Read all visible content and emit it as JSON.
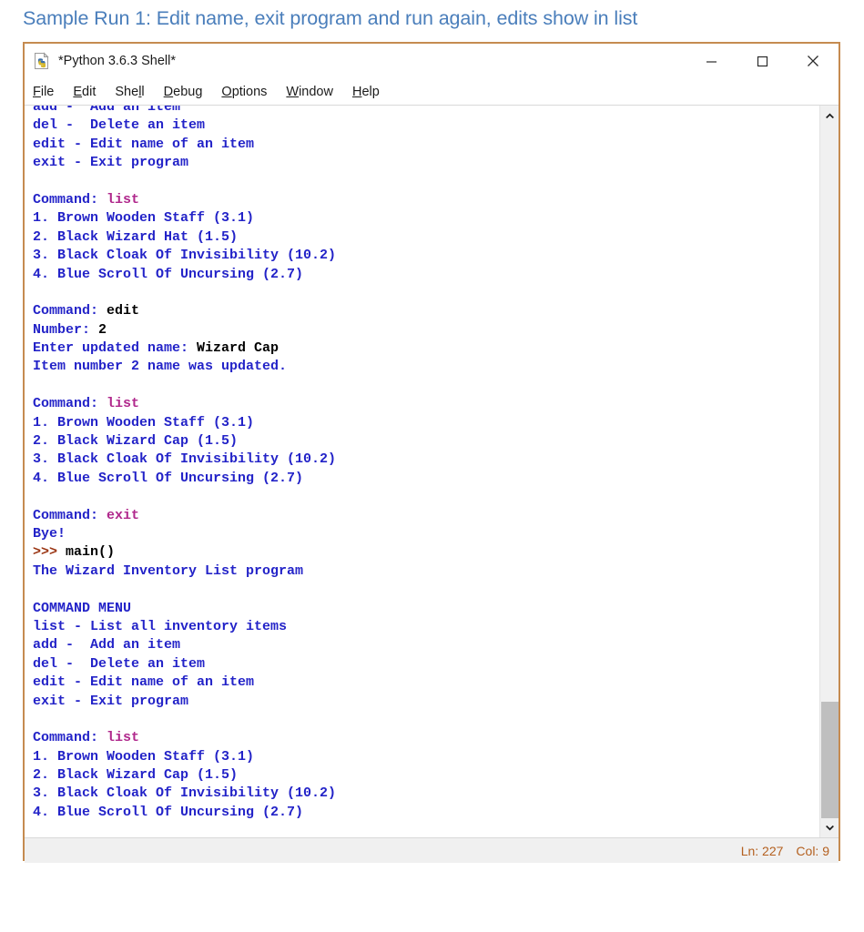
{
  "caption": "Sample Run 1: Edit name, exit program and run again, edits show in list",
  "window": {
    "title": "*Python 3.6.3 Shell*",
    "icon": "python-file-icon",
    "controls": {
      "minimize": "minimize-icon",
      "maximize": "maximize-icon",
      "close": "close-icon"
    }
  },
  "menubar": {
    "items": [
      {
        "label": "File",
        "accel_index": 0
      },
      {
        "label": "Edit",
        "accel_index": 0
      },
      {
        "label": "Shell",
        "accel_index": 3
      },
      {
        "label": "Debug",
        "accel_index": 0
      },
      {
        "label": "Options",
        "accel_index": 0
      },
      {
        "label": "Window",
        "accel_index": 0
      },
      {
        "label": "Help",
        "accel_index": 0
      }
    ]
  },
  "shell": {
    "scrollbar": {
      "up_arrow": "chevron-up-icon",
      "down_arrow": "chevron-down-icon",
      "thumb": "scrollbar-thumb"
    },
    "lines": [
      [
        {
          "t": "add -  Add an item",
          "c": "out"
        }
      ],
      [
        {
          "t": "del -  Delete an item",
          "c": "out"
        }
      ],
      [
        {
          "t": "edit - Edit name of an item",
          "c": "out"
        }
      ],
      [
        {
          "t": "exit - Exit program",
          "c": "out"
        }
      ],
      [
        {
          "t": "",
          "c": "out"
        }
      ],
      [
        {
          "t": "Command: ",
          "c": "out"
        },
        {
          "t": "list",
          "c": "in"
        }
      ],
      [
        {
          "t": "1. Brown Wooden Staff (3.1)",
          "c": "out"
        }
      ],
      [
        {
          "t": "2. Black Wizard Hat (1.5)",
          "c": "out"
        }
      ],
      [
        {
          "t": "3. Black Cloak Of Invisibility (10.2)",
          "c": "out"
        }
      ],
      [
        {
          "t": "4. Blue Scroll Of Uncursing (2.7)",
          "c": "out"
        }
      ],
      [
        {
          "t": "",
          "c": "out"
        }
      ],
      [
        {
          "t": "Command: ",
          "c": "out"
        },
        {
          "t": "edit",
          "c": "user"
        }
      ],
      [
        {
          "t": "Number: ",
          "c": "out"
        },
        {
          "t": "2",
          "c": "user"
        }
      ],
      [
        {
          "t": "Enter updated name: ",
          "c": "out"
        },
        {
          "t": "Wizard Cap",
          "c": "user"
        }
      ],
      [
        {
          "t": "Item number 2 name was updated.",
          "c": "out"
        }
      ],
      [
        {
          "t": "",
          "c": "out"
        }
      ],
      [
        {
          "t": "Command: ",
          "c": "out"
        },
        {
          "t": "list",
          "c": "in"
        }
      ],
      [
        {
          "t": "1. Brown Wooden Staff (3.1)",
          "c": "out"
        }
      ],
      [
        {
          "t": "2. Black Wizard Cap (1.5)",
          "c": "out"
        }
      ],
      [
        {
          "t": "3. Black Cloak Of Invisibility (10.2)",
          "c": "out"
        }
      ],
      [
        {
          "t": "4. Blue Scroll Of Uncursing (2.7)",
          "c": "out"
        }
      ],
      [
        {
          "t": "",
          "c": "out"
        }
      ],
      [
        {
          "t": "Command: ",
          "c": "out"
        },
        {
          "t": "exit",
          "c": "in"
        }
      ],
      [
        {
          "t": "Bye!",
          "c": "out"
        }
      ],
      [
        {
          "t": ">>> ",
          "c": "prompt"
        },
        {
          "t": "main()",
          "c": "user"
        }
      ],
      [
        {
          "t": "The Wizard Inventory List program",
          "c": "out"
        }
      ],
      [
        {
          "t": "",
          "c": "out"
        }
      ],
      [
        {
          "t": "COMMAND MENU",
          "c": "out"
        }
      ],
      [
        {
          "t": "list - List all inventory items",
          "c": "out"
        }
      ],
      [
        {
          "t": "add -  Add an item",
          "c": "out"
        }
      ],
      [
        {
          "t": "del -  Delete an item",
          "c": "out"
        }
      ],
      [
        {
          "t": "edit - Edit name of an item",
          "c": "out"
        }
      ],
      [
        {
          "t": "exit - Exit program",
          "c": "out"
        }
      ],
      [
        {
          "t": "",
          "c": "out"
        }
      ],
      [
        {
          "t": "Command: ",
          "c": "out"
        },
        {
          "t": "list",
          "c": "in"
        }
      ],
      [
        {
          "t": "1. Brown Wooden Staff (3.1)",
          "c": "out"
        }
      ],
      [
        {
          "t": "2. Black Wizard Cap (1.5)",
          "c": "out"
        }
      ],
      [
        {
          "t": "3. Black Cloak Of Invisibility (10.2)",
          "c": "out"
        }
      ],
      [
        {
          "t": "4. Blue Scroll Of Uncursing (2.7)",
          "c": "out"
        }
      ]
    ]
  },
  "statusbar": {
    "line": "Ln: 227",
    "col": "Col: 9"
  },
  "colors": {
    "caption": "#4a7ebb",
    "window_border": "#c58b50",
    "output_text": "#2323c8",
    "command_echo": "#b0288c",
    "user_input": "#000000",
    "prompt": "#9a3412",
    "status_text": "#b4601f",
    "scrollbar_thumb": "#bfbfbf"
  }
}
